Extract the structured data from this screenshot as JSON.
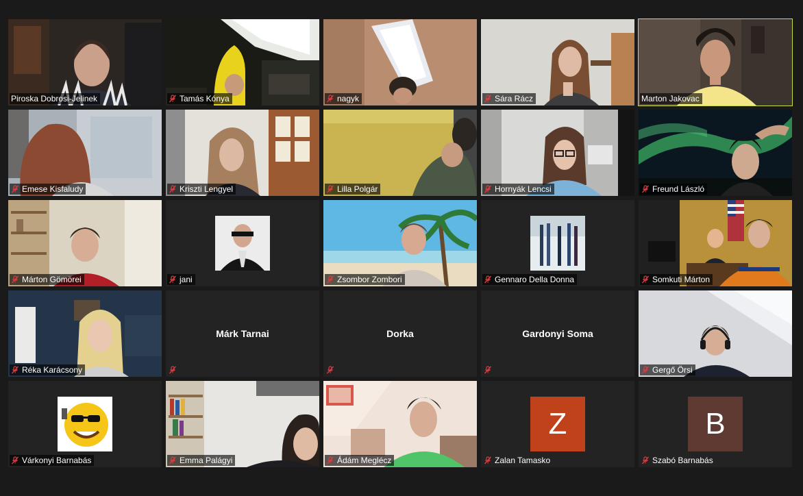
{
  "participants": [
    {
      "name": "Piroska Dobrosi-Jelinek",
      "muted": false,
      "active": false,
      "video": "teacher"
    },
    {
      "name": "Tamás Kónya",
      "muted": true,
      "active": false,
      "video": "banana"
    },
    {
      "name": "nagyk",
      "muted": true,
      "active": false,
      "video": "attic"
    },
    {
      "name": "Sára Rácz",
      "muted": true,
      "active": false,
      "video": "girl-light"
    },
    {
      "name": "Marton Jakovac",
      "muted": false,
      "active": true,
      "video": "boy-yellow"
    },
    {
      "name": "Emese Kisfaludy",
      "muted": true,
      "active": false,
      "video": "redhair"
    },
    {
      "name": "Kriszti Lengyel",
      "muted": true,
      "active": false,
      "video": "girl-door"
    },
    {
      "name": "Lilla Polgár",
      "muted": true,
      "active": false,
      "video": "yellow-wall"
    },
    {
      "name": "Hornyák Lencsi",
      "muted": true,
      "active": false,
      "video": "girl-glasses"
    },
    {
      "name": "Freund László",
      "muted": true,
      "active": false,
      "video": "aurora"
    },
    {
      "name": "Márton Gömörei",
      "muted": true,
      "active": false,
      "video": "boy-shelves"
    },
    {
      "name": "jani",
      "muted": true,
      "active": false,
      "video": "avatar-suit"
    },
    {
      "name": "Zsombor Zombori",
      "muted": true,
      "active": false,
      "video": "beach"
    },
    {
      "name": "Gennaro Della Donna",
      "muted": true,
      "active": false,
      "video": "avatar-skis"
    },
    {
      "name": "Somkuti Márton",
      "muted": true,
      "active": false,
      "video": "office"
    },
    {
      "name": "Réka Karácsony",
      "muted": true,
      "active": false,
      "video": "blonde"
    },
    {
      "name": "Márk Tarnai",
      "muted": true,
      "active": false,
      "video": "name-only"
    },
    {
      "name": "Dorka",
      "muted": true,
      "active": false,
      "video": "name-only"
    },
    {
      "name": "Gardonyi Soma",
      "muted": true,
      "active": false,
      "video": "name-only"
    },
    {
      "name": "Gergő Örsi",
      "muted": true,
      "active": false,
      "video": "headphones"
    },
    {
      "name": "Várkonyi Barnabás",
      "muted": true,
      "active": false,
      "video": "avatar-smiley"
    },
    {
      "name": "Emma Palágyi",
      "muted": true,
      "active": false,
      "video": "bookshelf"
    },
    {
      "name": "Ádám Meglécz",
      "muted": true,
      "active": false,
      "video": "boy-green"
    },
    {
      "name": "Zalan Tamasko",
      "muted": true,
      "active": false,
      "video": "letter",
      "letter": "Z",
      "color": "#c0421a"
    },
    {
      "name": "Szabó Barnabás",
      "muted": true,
      "active": false,
      "video": "letter",
      "letter": "B",
      "color": "#5e3a32"
    }
  ],
  "colors": {
    "background": "#1a1a1a",
    "tile": "#232323",
    "active_speaker_border": "#c9e04a",
    "mute_icon": "#e0393e"
  }
}
